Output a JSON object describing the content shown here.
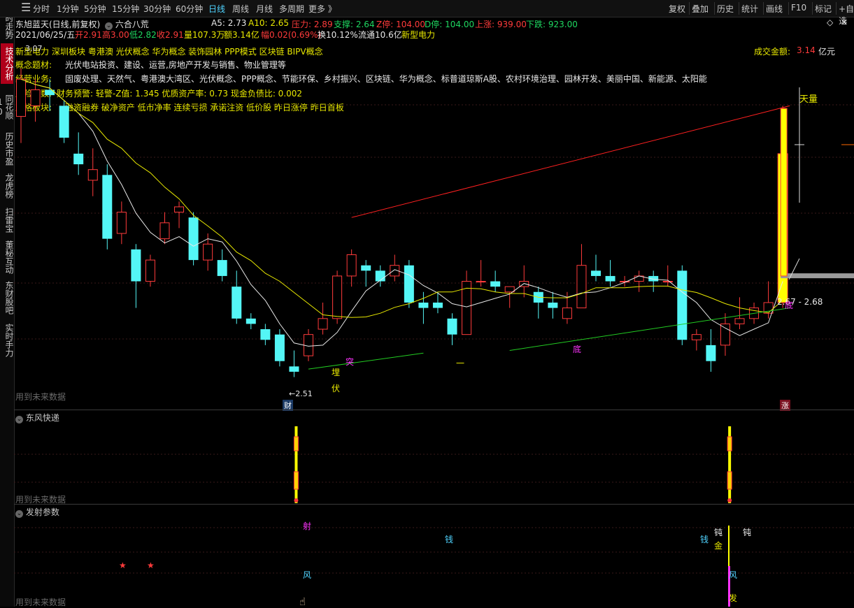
{
  "toolbar": {
    "items": [
      "分时",
      "1分钟",
      "5分钟",
      "15分钟",
      "30分钟",
      "60分钟",
      "日线",
      "周线",
      "月线",
      "多周期",
      "更多 》"
    ],
    "active_index": 6,
    "right_items": [
      "复权",
      "叠加",
      "历史",
      "统计",
      "画线",
      "F10",
      "标记",
      "+自选"
    ]
  },
  "left_tabs": [
    "分时走势",
    "技术分析",
    "同花顺10",
    "历史市盈",
    "龙虎榜",
    "扫雷宝",
    "董秘互动",
    "东财股吧",
    "实时手力"
  ],
  "left_tab_active": 1,
  "header": {
    "stock_name": "东旭蓝天(日线,前复权)",
    "formula": "六合八荒",
    "a5": "A5: 2.73",
    "a10": "A10: 2.65",
    "pressure": "压力: 2.89",
    "support": "支撑: 2.64",
    "z_stop": "Z停: 104.00",
    "d_stop": "D停: 104.00",
    "up_count": "上涨: 939.00",
    "down_count": "下跌: 923.00"
  },
  "ohlc": {
    "date": "2021/06/25/五",
    "open": "开2.91",
    "high": "高3.00",
    "low": "低2.82",
    "close": "收2.91",
    "volume": "量107.3万",
    "amount": "额3.14亿",
    "change": "幅0.02(0.69%)",
    "turnover": "换10.12%",
    "float": "流通10.6亿",
    "sector": "新型电力"
  },
  "concepts": {
    "line1_prefix": "新型电力",
    "line1": "深圳板块  粤港澳  光伏概念  华为概念  装饰园林  PPP模式  区块链  BIPV概念",
    "amount_label": "成交金额:",
    "amount_value": "3.14",
    "amount_unit": "亿元",
    "theme_label": "概念题材:",
    "theme_text": "光伏电站投资、建设、运营,房地产开发与销售、物业管理等",
    "business_label": "经营业务:",
    "business_text": "固废处理、天然气、粤港澳大湾区、光伏概念、PPP概念、节能环保、乡村振兴、区块链、华为概念、标普道琼斯A股、农村环境治理、园林开发、美丽中国、新能源、太阳能",
    "risk_label": "风险系数:",
    "risk_text": "财务预警: 轻警-Z值: 1.345  优质资产率: 0.73  现金负债比: 0.002",
    "style_label": "风格板块:",
    "style_text": "融资融券  破净资产  低市净率  连续亏损  承诺注资  低价股  昨日涨停  昨日首板"
  },
  "chart_labels": {
    "top_price": "3.07",
    "low_price": "←2.51",
    "range_label": "2.67 - 2.68",
    "tianliang": "天量",
    "cai": "财",
    "zhang": "涨",
    "mai": "埋",
    "tu": "突",
    "fu": "伏",
    "di": "底",
    "yi": "一"
  },
  "panels": {
    "main_future": "用到未来数据",
    "panel2_title": "东风快递",
    "panel2_future": "用到未来数据",
    "panel3_title": "发射参数",
    "panel3_future": "用到未来数据"
  },
  "panel3_labels": {
    "she": "射",
    "qian1": "钱",
    "qian2": "钱",
    "feng1": "风",
    "feng2": "风",
    "dun1": "钝",
    "dun2": "钝",
    "jin": "金",
    "fa": "发",
    "star": "★"
  },
  "colors": {
    "up": "#ff3b3b",
    "down": "#54f6f6",
    "ma_white": "#e8e8e8",
    "ma_yellow": "#e8e800",
    "trend_green": "#22cc22",
    "trend_red": "#ff2020",
    "signal_yellow": "#ffff00"
  },
  "chart_data": {
    "type": "candlestick",
    "ylim": [
      2.45,
      3.12
    ],
    "candles": [
      {
        "o": 2.98,
        "h": 3.07,
        "l": 2.93,
        "c": 3.05
      },
      {
        "o": 3.0,
        "h": 3.05,
        "l": 2.97,
        "c": 3.03
      },
      {
        "o": 3.03,
        "h": 3.05,
        "l": 2.99,
        "c": 3.02
      },
      {
        "o": 3.0,
        "h": 3.01,
        "l": 2.93,
        "c": 2.94
      },
      {
        "o": 2.91,
        "h": 2.95,
        "l": 2.87,
        "c": 2.89
      },
      {
        "o": 2.86,
        "h": 2.92,
        "l": 2.83,
        "c": 2.88
      },
      {
        "o": 2.87,
        "h": 2.89,
        "l": 2.73,
        "c": 2.75
      },
      {
        "o": 2.76,
        "h": 2.82,
        "l": 2.74,
        "c": 2.8
      },
      {
        "o": 2.73,
        "h": 2.74,
        "l": 2.62,
        "c": 2.67
      },
      {
        "o": 2.67,
        "h": 2.72,
        "l": 2.66,
        "c": 2.71
      },
      {
        "o": 2.75,
        "h": 2.8,
        "l": 2.74,
        "c": 2.78
      },
      {
        "o": 2.8,
        "h": 2.82,
        "l": 2.77,
        "c": 2.81
      },
      {
        "o": 2.79,
        "h": 2.8,
        "l": 2.7,
        "c": 2.71
      },
      {
        "o": 2.71,
        "h": 2.76,
        "l": 2.69,
        "c": 2.74
      },
      {
        "o": 2.71,
        "h": 2.73,
        "l": 2.67,
        "c": 2.68
      },
      {
        "o": 2.66,
        "h": 2.69,
        "l": 2.59,
        "c": 2.6
      },
      {
        "o": 2.6,
        "h": 2.61,
        "l": 2.58,
        "c": 2.59
      },
      {
        "o": 2.58,
        "h": 2.59,
        "l": 2.55,
        "c": 2.56
      },
      {
        "o": 2.57,
        "h": 2.58,
        "l": 2.51,
        "c": 2.52
      },
      {
        "o": 2.51,
        "h": 2.54,
        "l": 2.49,
        "c": 2.5
      },
      {
        "o": 2.53,
        "h": 2.58,
        "l": 2.52,
        "c": 2.57
      },
      {
        "o": 2.58,
        "h": 2.63,
        "l": 2.57,
        "c": 2.6
      },
      {
        "o": 2.6,
        "h": 2.69,
        "l": 2.59,
        "c": 2.68
      },
      {
        "o": 2.68,
        "h": 2.73,
        "l": 2.66,
        "c": 2.72
      },
      {
        "o": 2.7,
        "h": 2.71,
        "l": 2.66,
        "c": 2.69
      },
      {
        "o": 2.69,
        "h": 2.7,
        "l": 2.66,
        "c": 2.67
      },
      {
        "o": 2.68,
        "h": 2.72,
        "l": 2.67,
        "c": 2.7
      },
      {
        "o": 2.7,
        "h": 2.71,
        "l": 2.62,
        "c": 2.63
      },
      {
        "o": 2.63,
        "h": 2.65,
        "l": 2.59,
        "c": 2.62
      },
      {
        "o": 2.63,
        "h": 2.65,
        "l": 2.61,
        "c": 2.62
      },
      {
        "o": 2.6,
        "h": 2.61,
        "l": 2.55,
        "c": 2.57
      },
      {
        "o": 2.57,
        "h": 2.69,
        "l": 2.57,
        "c": 2.67
      },
      {
        "o": 2.67,
        "h": 2.71,
        "l": 2.66,
        "c": 2.67
      },
      {
        "o": 2.67,
        "h": 2.69,
        "l": 2.65,
        "c": 2.66
      },
      {
        "o": 2.65,
        "h": 2.66,
        "l": 2.62,
        "c": 2.66
      },
      {
        "o": 2.66,
        "h": 2.7,
        "l": 2.64,
        "c": 2.67
      },
      {
        "o": 2.65,
        "h": 2.66,
        "l": 2.6,
        "c": 2.63
      },
      {
        "o": 2.63,
        "h": 2.65,
        "l": 2.6,
        "c": 2.62
      },
      {
        "o": 2.6,
        "h": 2.65,
        "l": 2.59,
        "c": 2.62
      },
      {
        "o": 2.62,
        "h": 2.74,
        "l": 2.62,
        "c": 2.7
      },
      {
        "o": 2.69,
        "h": 2.72,
        "l": 2.67,
        "c": 2.68
      },
      {
        "o": 2.68,
        "h": 2.71,
        "l": 2.66,
        "c": 2.67
      },
      {
        "o": 2.67,
        "h": 2.68,
        "l": 2.66,
        "c": 2.67
      },
      {
        "o": 2.67,
        "h": 2.69,
        "l": 2.65,
        "c": 2.68
      },
      {
        "o": 2.68,
        "h": 2.69,
        "l": 2.65,
        "c": 2.67
      },
      {
        "o": 2.67,
        "h": 2.7,
        "l": 2.66,
        "c": 2.67
      },
      {
        "o": 2.69,
        "h": 2.7,
        "l": 2.55,
        "c": 2.56
      },
      {
        "o": 2.56,
        "h": 2.58,
        "l": 2.54,
        "c": 2.57
      },
      {
        "o": 2.55,
        "h": 2.58,
        "l": 2.5,
        "c": 2.52
      },
      {
        "o": 2.55,
        "h": 2.61,
        "l": 2.53,
        "c": 2.59
      },
      {
        "o": 2.59,
        "h": 2.64,
        "l": 2.58,
        "c": 2.6
      },
      {
        "o": 2.6,
        "h": 2.63,
        "l": 2.59,
        "c": 2.62
      },
      {
        "o": 2.61,
        "h": 2.67,
        "l": 2.6,
        "c": 2.63
      },
      {
        "o": 2.63,
        "h": 3.0,
        "l": 2.62,
        "c": 2.91
      }
    ]
  }
}
